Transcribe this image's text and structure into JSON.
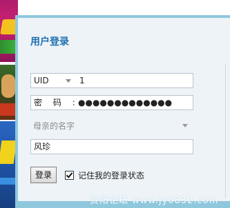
{
  "dialog": {
    "title": "用户登录"
  },
  "uid_row": {
    "selected_type": "UID",
    "value": "1"
  },
  "password_row": {
    "label": "密 码 :",
    "masked_value": "●●●●●●●●●●●●●"
  },
  "security_question": {
    "selected": "母亲的名字"
  },
  "answer": {
    "value": "风珍"
  },
  "actions": {
    "login_label": "登录",
    "remember_label": "记住我的登录状态",
    "remember_checked": true
  },
  "watermark": {
    "text": "资阳论坛 www.jy0832.com"
  },
  "colors": {
    "title": "#1d6fb0",
    "frame": "#8fc7dd",
    "panel": "#eef3f8"
  }
}
